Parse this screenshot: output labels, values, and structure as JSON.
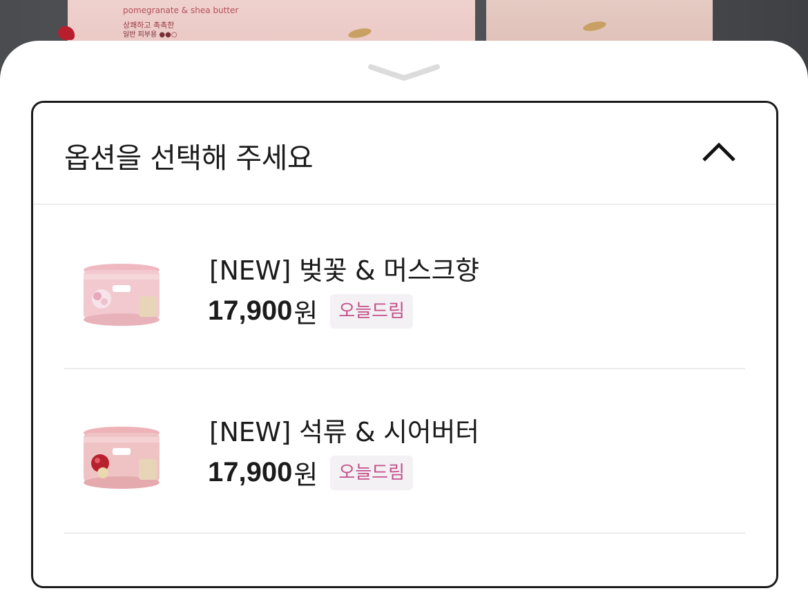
{
  "backdrop": {
    "product_label_line1": "pomegranate & shea butter",
    "product_label_line2": "상쾌하고 촉촉한",
    "product_label_line3": "일반 피부용 ●●○"
  },
  "sheet": {
    "handle_icon": "chevron-down-icon",
    "option_select": {
      "title": "옵션을 선택해 주세요",
      "toggle_icon": "chevron-up-icon",
      "items": [
        {
          "name": "[NEW] 벚꽃 & 머스크향",
          "price": "17,900",
          "currency": "원",
          "badge": "오늘드림",
          "thumb_color": "#f2c9cf"
        },
        {
          "name": "[NEW] 석류 & 시어버터",
          "price": "17,900",
          "currency": "원",
          "badge": "오늘드림",
          "thumb_color": "#efc3c4"
        }
      ]
    }
  },
  "colors": {
    "badge_text": "#c4508a",
    "badge_bg": "#f3f1f4",
    "border": "#1a1a1a",
    "divider": "#ececec"
  }
}
